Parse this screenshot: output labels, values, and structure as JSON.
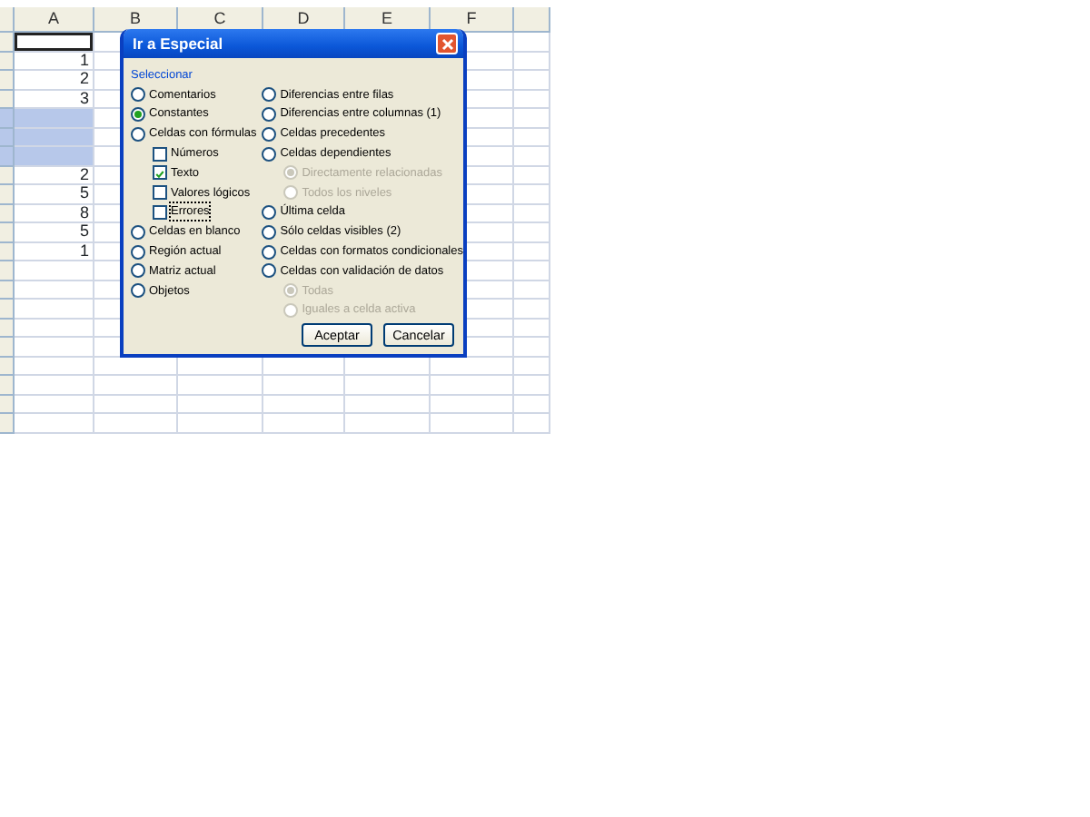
{
  "sheet": {
    "columns": [
      "A",
      "B",
      "C",
      "D",
      "E",
      "F"
    ],
    "rows": [
      {
        "value": "",
        "active": true,
        "selected": false
      },
      {
        "value": "1",
        "active": false,
        "selected": false
      },
      {
        "value": "2",
        "active": false,
        "selected": false
      },
      {
        "value": "3",
        "active": false,
        "selected": false
      },
      {
        "value": "",
        "active": false,
        "selected": true
      },
      {
        "value": "",
        "active": false,
        "selected": true
      },
      {
        "value": "",
        "active": false,
        "selected": true
      },
      {
        "value": "2",
        "active": false,
        "selected": false
      },
      {
        "value": "5",
        "active": false,
        "selected": false
      },
      {
        "value": "8",
        "active": false,
        "selected": false
      },
      {
        "value": "5",
        "active": false,
        "selected": false
      },
      {
        "value": "1",
        "active": false,
        "selected": false
      },
      {
        "value": "",
        "active": false,
        "selected": false
      },
      {
        "value": "",
        "active": false,
        "selected": false
      },
      {
        "value": "",
        "active": false,
        "selected": false
      },
      {
        "value": "",
        "active": false,
        "selected": false
      },
      {
        "value": "",
        "active": false,
        "selected": false
      },
      {
        "value": "",
        "active": false,
        "selected": false
      },
      {
        "value": "",
        "active": false,
        "selected": false
      },
      {
        "value": "",
        "active": false,
        "selected": false
      },
      {
        "value": "",
        "active": false,
        "selected": false
      }
    ]
  },
  "dialog": {
    "title": "Ir a Especial",
    "group_label": "Seleccionar",
    "left_options": [
      {
        "kind": "radio",
        "label": "Comentarios",
        "selected": false,
        "disabled": false
      },
      {
        "kind": "radio",
        "label": "Constantes",
        "selected": true,
        "disabled": false
      },
      {
        "kind": "radio",
        "label": "Celdas con fórmulas",
        "selected": false,
        "disabled": false,
        "children": [
          {
            "kind": "checkbox",
            "label": "Números",
            "checked": false,
            "focused": false
          },
          {
            "kind": "checkbox",
            "label": "Texto",
            "checked": true,
            "focused": false
          },
          {
            "kind": "checkbox",
            "label": "Valores lógicos",
            "checked": false,
            "focused": false
          },
          {
            "kind": "checkbox",
            "label": "Errores",
            "checked": false,
            "focused": true
          }
        ]
      },
      {
        "kind": "radio",
        "label": "Celdas en blanco",
        "selected": false,
        "disabled": false
      },
      {
        "kind": "radio",
        "label": "Región actual",
        "selected": false,
        "disabled": false
      },
      {
        "kind": "radio",
        "label": "Matriz actual",
        "selected": false,
        "disabled": false
      },
      {
        "kind": "radio",
        "label": "Objetos",
        "selected": false,
        "disabled": false
      }
    ],
    "right_options": [
      {
        "kind": "radio",
        "label": "Diferencias entre filas",
        "selected": false,
        "disabled": false
      },
      {
        "kind": "radio",
        "label": "Diferencias entre columnas (1)",
        "selected": false,
        "disabled": false
      },
      {
        "kind": "radio",
        "label": "Celdas precedentes",
        "selected": false,
        "disabled": false
      },
      {
        "kind": "radio",
        "label": "Celdas dependientes",
        "selected": false,
        "disabled": false,
        "children": [
          {
            "kind": "radio",
            "label": "Directamente relacionadas",
            "selected": true,
            "disabled": true
          },
          {
            "kind": "radio",
            "label": "Todos los niveles",
            "selected": false,
            "disabled": true
          }
        ]
      },
      {
        "kind": "radio",
        "label": "Última celda",
        "selected": false,
        "disabled": false
      },
      {
        "kind": "radio",
        "label": "Sólo celdas visibles (2)",
        "selected": false,
        "disabled": false
      },
      {
        "kind": "radio",
        "label": "Celdas con formatos condicionales",
        "selected": false,
        "disabled": false
      },
      {
        "kind": "radio",
        "label": "Celdas con validación de datos",
        "selected": false,
        "disabled": false,
        "children": [
          {
            "kind": "radio",
            "label": "Todas",
            "selected": true,
            "disabled": true
          },
          {
            "kind": "radio",
            "label": "Iguales a celda activa",
            "selected": false,
            "disabled": true
          }
        ]
      }
    ],
    "buttons": [
      "Aceptar",
      "Cancelar"
    ]
  }
}
